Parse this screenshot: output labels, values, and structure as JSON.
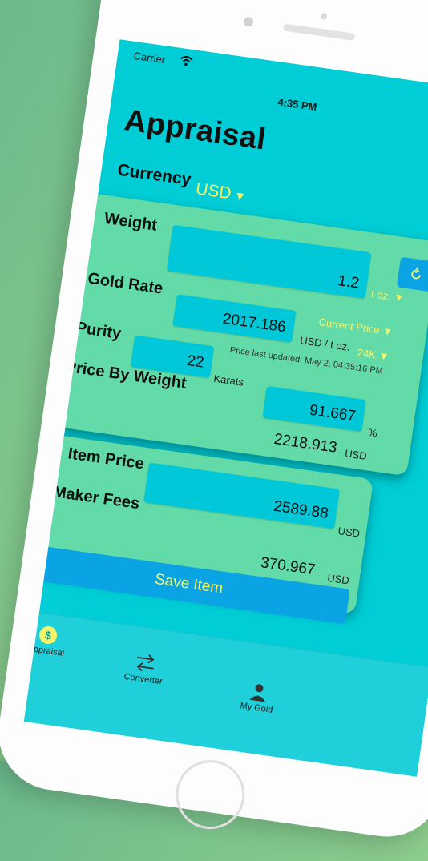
{
  "status": {
    "carrier": "Carrier",
    "time": "4:35 PM"
  },
  "title": "Appraisal",
  "currency": {
    "label": "Currency",
    "value": "USD"
  },
  "weight": {
    "label": "Weight",
    "value": "1.2",
    "unit": "t oz."
  },
  "gold_rate": {
    "label": "Gold Rate",
    "value": "2017.186",
    "unit": "USD / t oz.",
    "source": "Current Price",
    "purity_option": "24K",
    "last_updated": "Price last updated: May 2, 04:35:16 PM"
  },
  "purity": {
    "label": "Purity",
    "karats_value": "22",
    "karats_unit": "Karats",
    "percent_value": "91.667",
    "percent_unit": "%"
  },
  "price_by_weight": {
    "label": "Price By Weight",
    "value": "2218.913",
    "unit": "USD"
  },
  "item_price": {
    "label": "Item Price",
    "value": "2589.88",
    "unit": "USD"
  },
  "maker_fees": {
    "label": "Maker Fees",
    "value": "370.967",
    "unit": "USD"
  },
  "save_button": "Save Item",
  "tabs": [
    {
      "label": "Appraisal",
      "icon": "dollar-coin-icon"
    },
    {
      "label": "Converter",
      "icon": "arrows-exchange-icon"
    },
    {
      "label": "My Gold",
      "icon": "person-icon"
    }
  ],
  "colors": {
    "screen_bg": "#00cdd6",
    "card_bg": "#63dba8",
    "accent_yellow": "#f4f466",
    "button_blue": "#0aa4e4"
  }
}
